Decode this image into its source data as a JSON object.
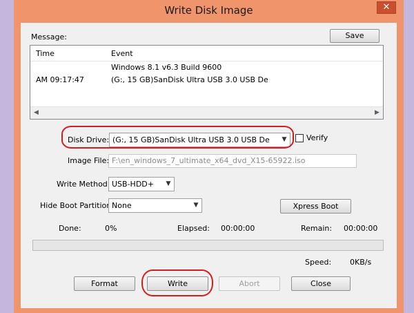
{
  "window": {
    "title": "Write Disk Image",
    "close_glyph": "✕"
  },
  "message": {
    "label": "Message:",
    "save_label": "Save",
    "columns": [
      "Time",
      "Event"
    ],
    "rows": [
      {
        "time": "",
        "event": "Windows 8.1 v6.3 Build 9600"
      },
      {
        "time": "AM 09:17:47",
        "event": "(G:, 15 GB)SanDisk Ultra USB 3.0 USB De"
      }
    ]
  },
  "disk_drive": {
    "label": "Disk Drive:",
    "value": "(G:, 15 GB)SanDisk Ultra USB 3.0 USB De"
  },
  "verify": {
    "label": "Verify",
    "checked": false
  },
  "image_file": {
    "label": "Image File:",
    "value": "F:\\en_windows_7_ultimate_x64_dvd_X15-65922.iso"
  },
  "write_method": {
    "label": "Write Method:",
    "value": "USB-HDD+"
  },
  "hide_boot": {
    "label": "Hide Boot Partition:",
    "value": "None"
  },
  "xpress_boot_label": "Xpress Boot",
  "status": {
    "done_label": "Done:",
    "done_value": "0%",
    "elapsed_label": "Elapsed:",
    "elapsed_value": "00:00:00",
    "remain_label": "Remain:",
    "remain_value": "00:00:00",
    "speed_label": "Speed:",
    "speed_value": "0KB/s",
    "progress_fraction": 0
  },
  "buttons": {
    "format": "Format",
    "write": "Write",
    "abort": "Abort",
    "close": "Close"
  },
  "colors": {
    "window_frame": "#f0956b",
    "client_bg": "#f0f0f0",
    "desktop": "#c5b6dd",
    "annotation": "#d61b1b",
    "close_button": "#c9502f"
  },
  "icons": {
    "dropdown": "chevron-down-icon",
    "scroll_left": "arrow-left-icon",
    "scroll_right": "arrow-right-icon"
  }
}
